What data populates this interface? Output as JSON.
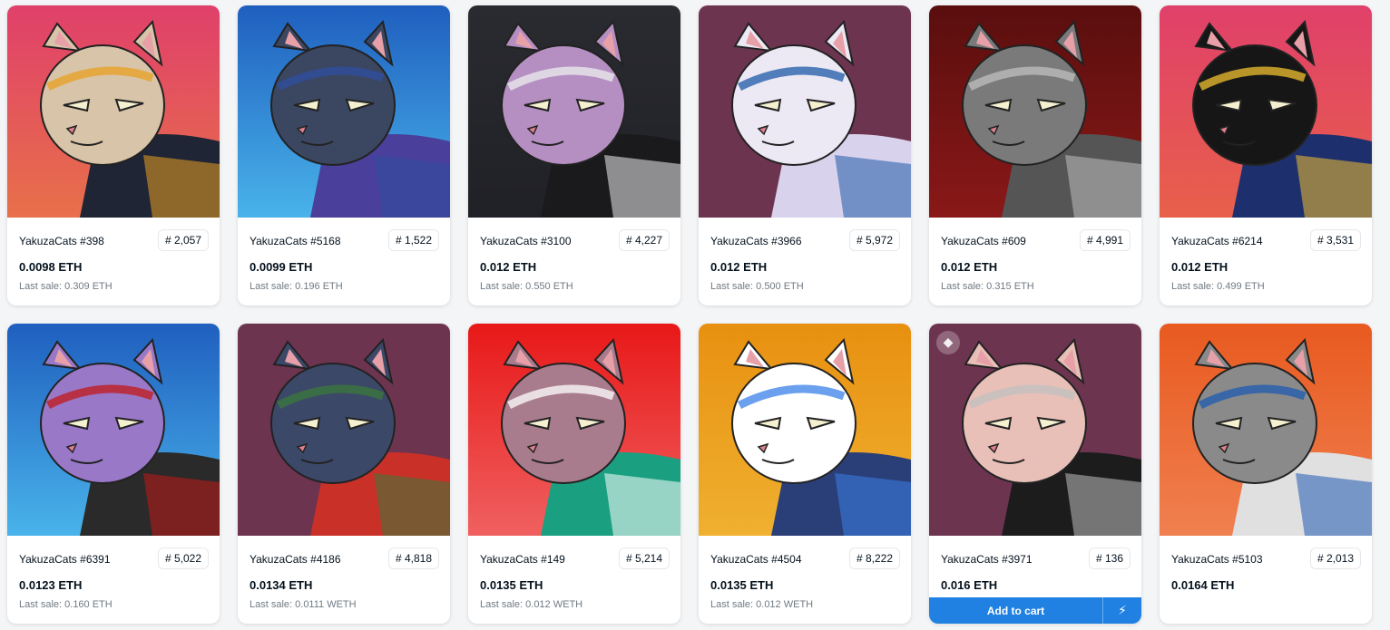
{
  "collection": "YakuzaCats",
  "cards": [
    {
      "name": "YakuzaCats #398",
      "rank": "# 2,057",
      "price": "0.0098 ETH",
      "last_sale": "Last sale: 0.309 ETH",
      "bg_top": "#e0406a",
      "bg_bottom": "#e8704a",
      "fur": "#d8c4a8",
      "accent": "#e8a020",
      "body": "#1f2535"
    },
    {
      "name": "YakuzaCats #5168",
      "rank": "# 1,522",
      "price": "0.0099 ETH",
      "last_sale": "Last sale: 0.196 ETH",
      "bg_top": "#1f5fbf",
      "bg_bottom": "#49b3ea",
      "fur": "#3b4660",
      "accent": "#2f4fa0",
      "body": "#4a3f9a"
    },
    {
      "name": "YakuzaCats #3100",
      "rank": "# 4,227",
      "price": "0.012 ETH",
      "last_sale": "Last sale: 0.550 ETH",
      "bg_top": "#2a2b30",
      "bg_bottom": "#202126",
      "fur": "#b58fc2",
      "accent": "#eeeeee",
      "body": "#1a1a1d"
    },
    {
      "name": "YakuzaCats #3966",
      "rank": "# 5,972",
      "price": "0.012 ETH",
      "last_sale": "Last sale: 0.500 ETH",
      "bg_top": "#6d3450",
      "bg_bottom": "#6d3450",
      "fur": "#ece8f4",
      "accent": "#1e5aa8",
      "body": "#d9d2ec"
    },
    {
      "name": "YakuzaCats #609",
      "rank": "# 4,991",
      "price": "0.012 ETH",
      "last_sale": "Last sale: 0.315 ETH",
      "bg_top": "#5a0e0e",
      "bg_bottom": "#8a1818",
      "fur": "#7a7a7a",
      "accent": "#c0c0c0",
      "body": "#555555"
    },
    {
      "name": "YakuzaCats #6214",
      "rank": "# 3,531",
      "price": "0.012 ETH",
      "last_sale": "Last sale: 0.499 ETH",
      "bg_top": "#e0406a",
      "bg_bottom": "#e8604a",
      "fur": "#161616",
      "accent": "#f0c030",
      "body": "#1e2f6e"
    },
    {
      "name": "YakuzaCats #6391",
      "rank": "# 5,022",
      "price": "0.0123 ETH",
      "last_sale": "Last sale: 0.160 ETH",
      "bg_top": "#1f5fbf",
      "bg_bottom": "#49b3ea",
      "fur": "#9a78c8",
      "accent": "#c01818",
      "body": "#2a2a2a"
    },
    {
      "name": "YakuzaCats #4186",
      "rank": "# 4,818",
      "price": "0.0134 ETH",
      "last_sale": "Last sale: 0.0111 WETH",
      "bg_top": "#6d3450",
      "bg_bottom": "#6d3450",
      "fur": "#3c4868",
      "accent": "#3a7a3a",
      "body": "#c83028"
    },
    {
      "name": "YakuzaCats #149",
      "rank": "# 5,214",
      "price": "0.0135 ETH",
      "last_sale": "Last sale: 0.012 WETH",
      "bg_top": "#e81818",
      "bg_bottom": "#f06060",
      "fur": "#a87c8c",
      "accent": "#ffffff",
      "body": "#1aa080"
    },
    {
      "name": "YakuzaCats #4504",
      "rank": "# 8,222",
      "price": "0.0135 ETH",
      "last_sale": "Last sale: 0.012 WETH",
      "bg_top": "#e89010",
      "bg_bottom": "#f0b030",
      "fur": "#ffffff",
      "accent": "#3a80e8",
      "body": "#2a3f78"
    },
    {
      "name": "YakuzaCats #3971",
      "rank": "# 136",
      "price": "0.016 ETH",
      "last_sale": "",
      "bg_top": "#6d3450",
      "bg_bottom": "#6d3450",
      "fur": "#e8c0b8",
      "accent": "#c0c0c0",
      "body": "#1c1c1c"
    },
    {
      "name": "YakuzaCats #5103",
      "rank": "# 2,013",
      "price": "0.0164 ETH",
      "last_sale": "",
      "bg_top": "#e85a20",
      "bg_bottom": "#f08050",
      "fur": "#8a8a8a",
      "accent": "#1e5ab0",
      "body": "#e0e0e0"
    }
  ],
  "cart": {
    "add_label": "Add to cart",
    "buy_icon": "lightning-icon",
    "buy_glyph": "⚡"
  },
  "eth_badge": {
    "icon": "ethereum-icon",
    "glyph": "◆"
  }
}
